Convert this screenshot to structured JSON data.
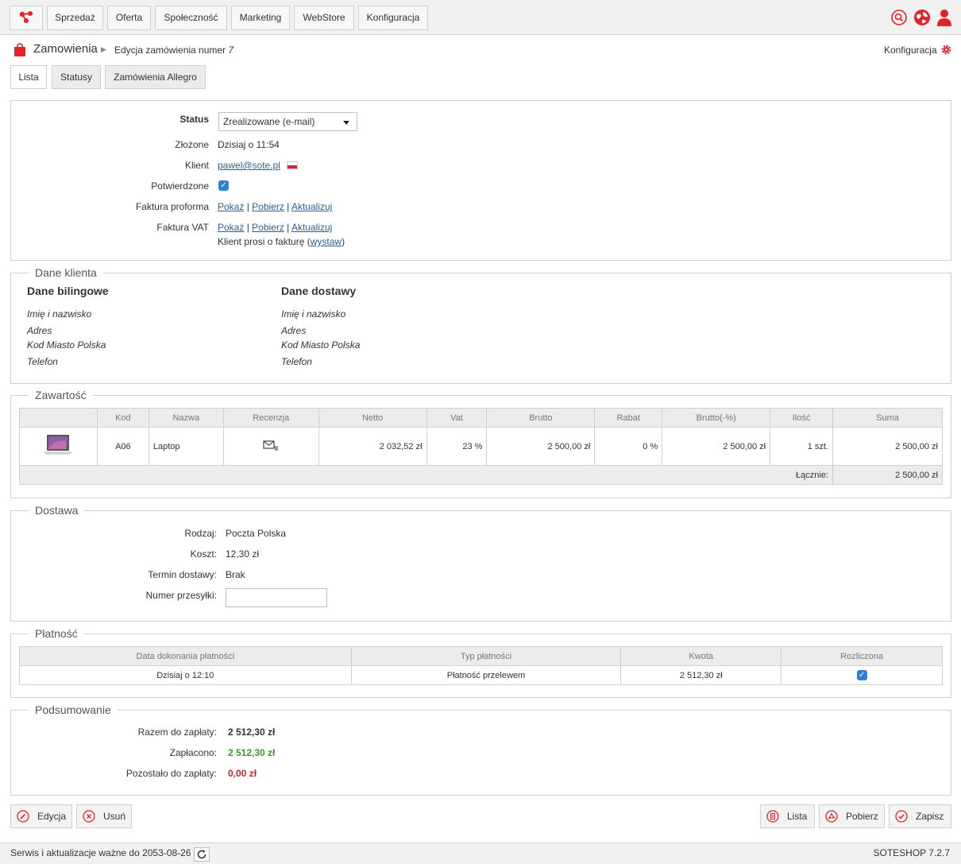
{
  "nav": {
    "items": [
      "Sprzedaż",
      "Oferta",
      "Społeczność",
      "Marketing",
      "WebStore",
      "Konfiguracja"
    ],
    "icons": [
      "search-icon",
      "globe-icon",
      "user-icon"
    ]
  },
  "breadcrumb": {
    "section": "Zamowienia",
    "page_prefix": "Edycja zamówienia numer",
    "order_number": "7",
    "config_label": "Konfiguracja"
  },
  "tabs": [
    "Lista",
    "Statusy",
    "Zamówienia Allegro"
  ],
  "order": {
    "status_label": "Status",
    "status_value": "Zrealizowane (e-mail)",
    "placed_label": "Złożone",
    "placed_value": "Dzisiaj o 11:54",
    "client_label": "Klient",
    "client_email": "pawel@sote.pl",
    "confirmed_label": "Potwierdzone",
    "proforma_label": "Faktura proforma",
    "vat_label": "Faktura VAT",
    "link_show": "Pokaż",
    "link_download": "Pobierz",
    "link_update": "Aktualizuj",
    "invoice_request_prefix": "Klient prosi o fakturę (",
    "invoice_request_link": "wystaw",
    "invoice_request_suffix": ")"
  },
  "client": {
    "legend": "Dane klienta",
    "billing_title": "Dane bilingowe",
    "shipping_title": "Dane dostawy",
    "fields": [
      "Imię i nazwisko",
      "Adres",
      "Kod Miasto Polska",
      "Telefon"
    ]
  },
  "contents": {
    "legend": "Zawartość",
    "columns": [
      "",
      "Kod",
      "Nazwa",
      "Recenzja",
      "Netto",
      "Vat",
      "Brutto",
      "Rabat",
      "Brutto(-%)",
      "Ilość",
      "Suma"
    ],
    "row": {
      "code": "A06",
      "name": "Laptop",
      "netto": "2 032,52 zł",
      "vat": "23 %",
      "brutto": "2 500,00 zł",
      "rabat": "0 %",
      "brutto_disc": "2 500,00 zł",
      "qty": "1 szt.",
      "sum": "2 500,00 zł"
    },
    "total_label": "Łącznie:",
    "total_value": "2 500,00 zł"
  },
  "shipping": {
    "legend": "Dostawa",
    "type_label": "Rodzaj:",
    "type_value": "Poczta Polska",
    "cost_label": "Koszt:",
    "cost_value": "12,30 zł",
    "term_label": "Termin dostawy:",
    "term_value": "Brak",
    "tracking_label": "Numer przesyłki:",
    "tracking_value": ""
  },
  "payment": {
    "legend": "Płatność",
    "columns": [
      "Data dokonania płatności",
      "Typ płatności",
      "Kwota",
      "Rozliczona"
    ],
    "date": "Dzisiaj o 12:10",
    "type": "Płatność przelewem",
    "amount": "2 512,30 zł",
    "settled": true
  },
  "summary": {
    "legend": "Podsumowanie",
    "total_label": "Razem do zapłaty:",
    "total_value": "2 512,30 zł",
    "paid_label": "Zapłacono:",
    "paid_value": "2 512,30 zł",
    "remaining_label": "Pozostało do zapłaty:",
    "remaining_value": "0,00 zł"
  },
  "actions": {
    "edit": "Edycja",
    "delete": "Usuń",
    "list": "Lista",
    "download": "Pobierz",
    "save": "Zapisz"
  },
  "footer": {
    "service_text": "Serwis i aktualizacje ważne do 2053-08-26",
    "version": "SOTESHOP 7.2.7"
  },
  "colors": {
    "accent_red": "#e2232a",
    "paid_green": "#3c9a25",
    "remaining_red": "#c0282e",
    "link_blue": "#2b5f94"
  }
}
